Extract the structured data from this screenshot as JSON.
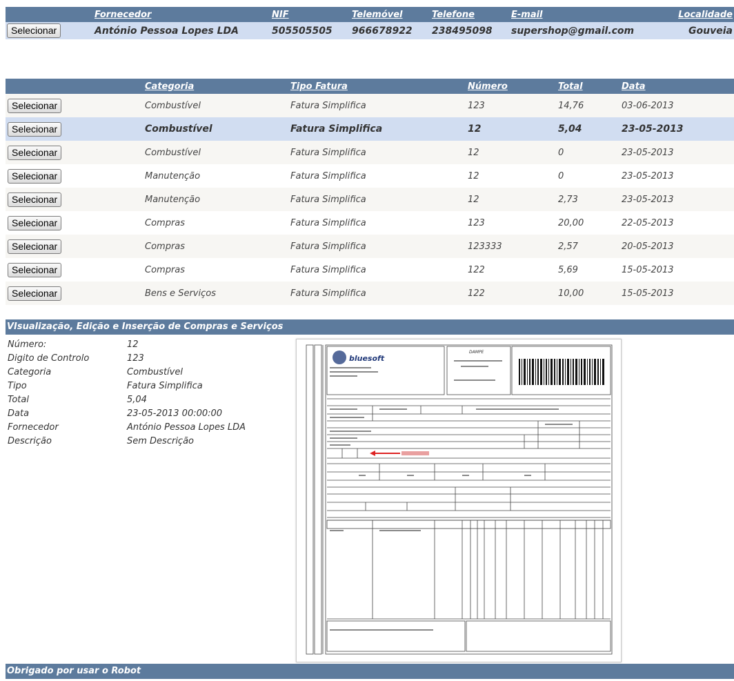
{
  "supplier_grid": {
    "headers": [
      "Fornecedor",
      "NIF",
      "Telemóvel",
      "Telefone",
      "E-mail",
      "Localidade"
    ],
    "row": {
      "button": "Selecionar",
      "fornecedor": "António Pessoa Lopes LDA",
      "nif": "505505505",
      "telemovel": "966678922",
      "telefone": "238495098",
      "email": "supershop@gmail.com",
      "localidade": "Gouveia"
    }
  },
  "invoice_grid": {
    "headers": [
      "Categoria",
      "Tipo Fatura",
      "Número",
      "Total",
      "Data"
    ],
    "button_label": "Selecionar",
    "rows": [
      {
        "categoria": "Combustível",
        "tipo": "Fatura Simplifica",
        "numero": "123",
        "total": "14,76",
        "data": "03-06-2013"
      },
      {
        "categoria": "Combustível",
        "tipo": "Fatura Simplifica",
        "numero": "12",
        "total": "5,04",
        "data": "23-05-2013"
      },
      {
        "categoria": "Combustível",
        "tipo": "Fatura Simplifica",
        "numero": "12",
        "total": "0",
        "data": "23-05-2013"
      },
      {
        "categoria": "Manutenção",
        "tipo": "Fatura Simplifica",
        "numero": "12",
        "total": "0",
        "data": "23-05-2013"
      },
      {
        "categoria": "Manutenção",
        "tipo": "Fatura Simplifica",
        "numero": "12",
        "total": "2,73",
        "data": "23-05-2013"
      },
      {
        "categoria": "Compras",
        "tipo": "Fatura Simplifica",
        "numero": "123",
        "total": "20,00",
        "data": "22-05-2013"
      },
      {
        "categoria": "Compras",
        "tipo": "Fatura Simplifica",
        "numero": "123333",
        "total": "2,57",
        "data": "20-05-2013"
      },
      {
        "categoria": "Compras",
        "tipo": "Fatura Simplifica",
        "numero": "122",
        "total": "5,69",
        "data": "15-05-2013"
      },
      {
        "categoria": "Bens e Serviços",
        "tipo": "Fatura Simplifica",
        "numero": "122",
        "total": "10,00",
        "data": "15-05-2013"
      }
    ],
    "selected_index": 1
  },
  "panel": {
    "title": "VIsualização, Edição e Inserção de Compras e Serviços",
    "fields": [
      {
        "label": "Número:",
        "value": "12"
      },
      {
        "label": "Digito de Controlo",
        "value": "123"
      },
      {
        "label": "Categoria",
        "value": "Combustível"
      },
      {
        "label": "Tipo",
        "value": "Fatura Simplifica"
      },
      {
        "label": "Total",
        "value": "5,04"
      },
      {
        "label": "Data",
        "value": "23-05-2013 00:00:00"
      },
      {
        "label": "Fornecedor",
        "value": "António Pessoa Lopes LDA"
      },
      {
        "label": "Descrição",
        "value": "Sem Descrição"
      }
    ]
  },
  "document_image": {
    "logo_text": "bluesoft",
    "heading": "DAMPE"
  },
  "footer": {
    "text": "Obrigado por usar o Robot"
  },
  "colors": {
    "header_bar": "#5d7b9d",
    "selected_row": "#d1ddf1",
    "alt_row": "#f7f6f3"
  }
}
